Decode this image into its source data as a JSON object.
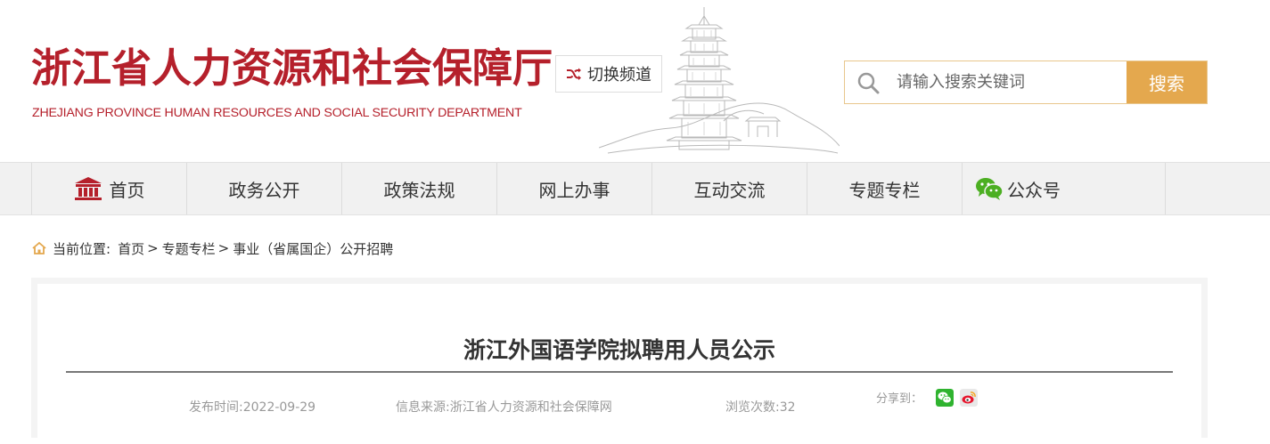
{
  "header": {
    "logo_cn": "浙江省人力资源和社会保障厅",
    "logo_en": "ZHEJIANG PROVINCE HUMAN RESOURCES AND SOCIAL SECURITY DEPARTMENT",
    "switch_label": "切换频道",
    "search": {
      "placeholder": "请输入搜索关键词",
      "button": "搜索"
    },
    "colors": {
      "brand": "#b5202b",
      "accent": "#e4a84e"
    }
  },
  "nav": {
    "items": [
      {
        "label": "首页",
        "icon": "building-icon"
      },
      {
        "label": "政务公开"
      },
      {
        "label": "政策法规"
      },
      {
        "label": "网上办事"
      },
      {
        "label": "互动交流"
      },
      {
        "label": "专题专栏"
      },
      {
        "label": "公众号",
        "icon": "wechat-icon"
      }
    ]
  },
  "breadcrumb": {
    "prefix": "当前位置:",
    "items": [
      "首页",
      "专题专栏",
      "事业（省属国企）公开招聘"
    ],
    "separator": ">"
  },
  "article": {
    "title": "浙江外国语学院拟聘用人员公示",
    "publish_time": "发布时间:2022-09-29",
    "source": "信息来源:浙江省人力资源和社会保障网",
    "views": "浏览次数:32",
    "share_label": "分享到：",
    "share_icons": [
      "wechat-share-icon",
      "weibo-share-icon"
    ]
  }
}
